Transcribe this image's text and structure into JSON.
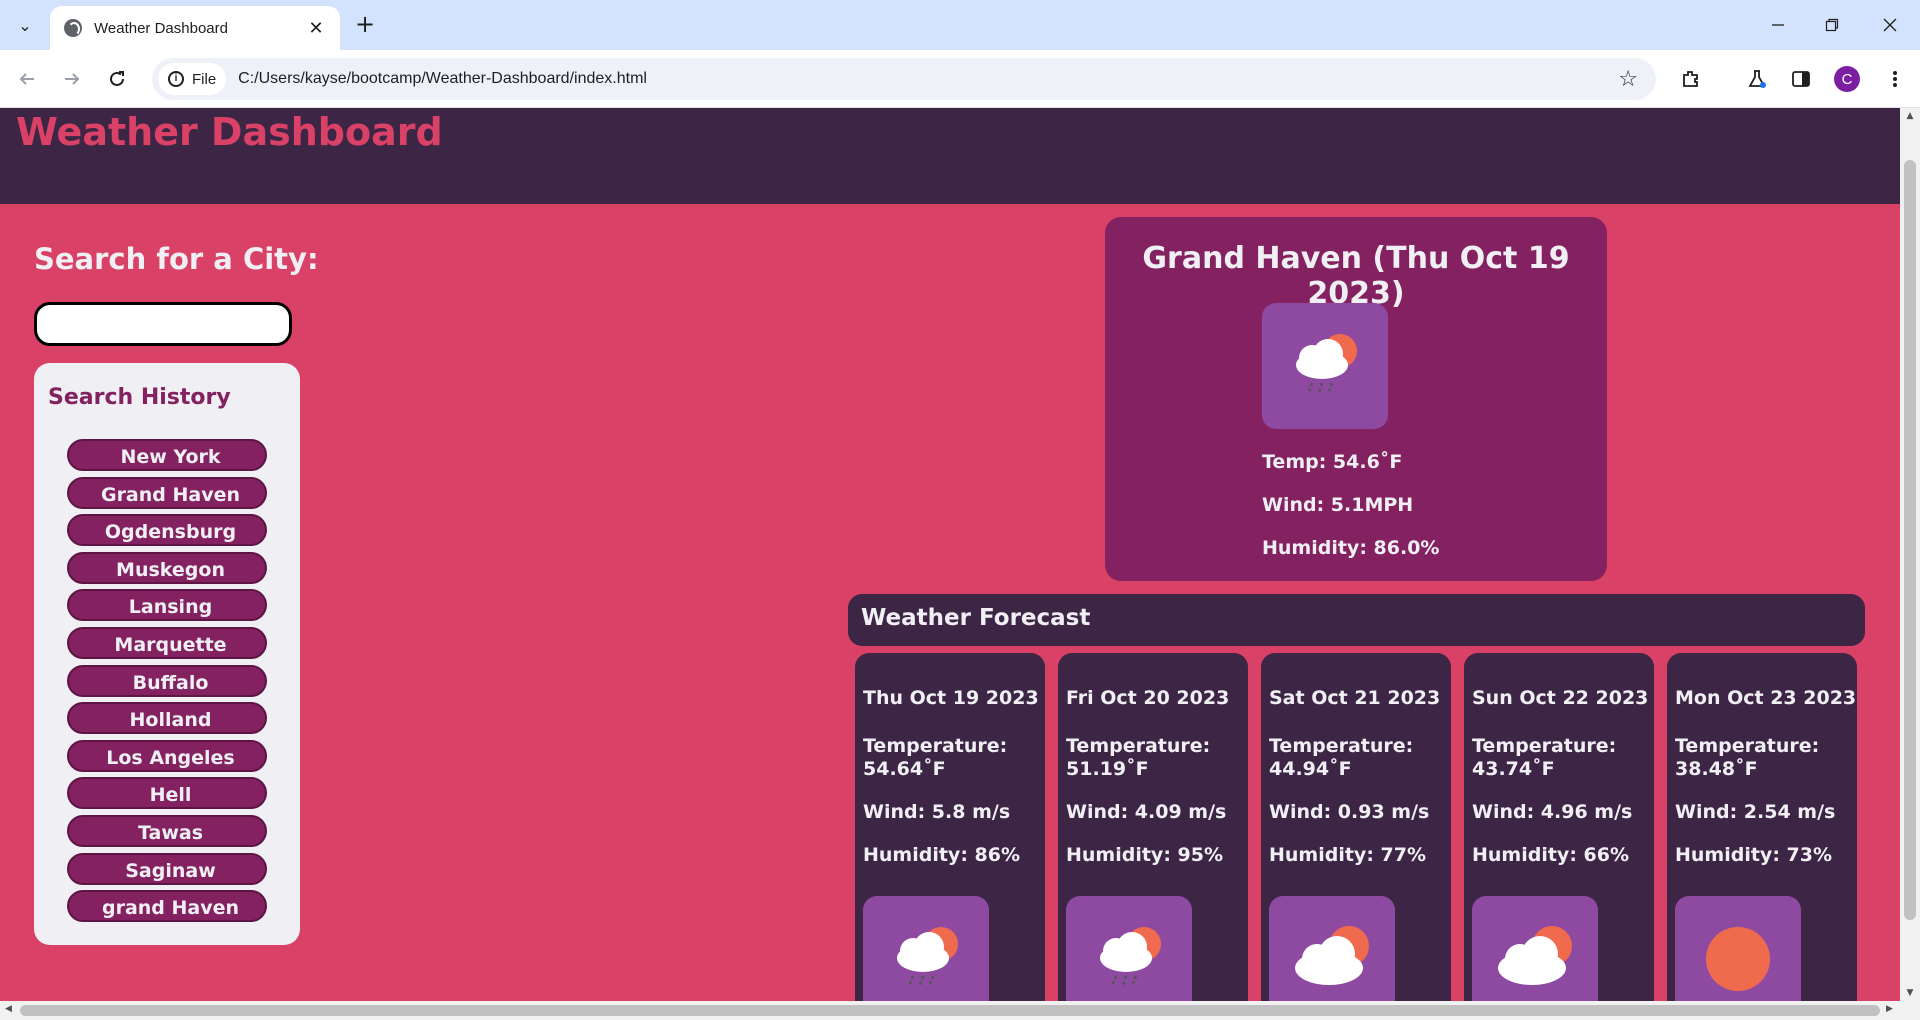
{
  "browser": {
    "tab_title": "Weather Dashboard",
    "tab_close": "✕",
    "new_tab": "+",
    "site_chip": "File",
    "url": "C:/Users/kayse/bootcamp/Weather-Dashboard/index.html",
    "profile_initial": "C"
  },
  "page": {
    "title": "Weather Dashboard",
    "search_label": "Search for a City:",
    "search_value": "",
    "history_title": "Search History",
    "history": [
      "New York",
      "Grand Haven",
      "Ogdensburg",
      "Muskegon",
      "Lansing",
      "Marquette",
      "Buffalo",
      "Holland",
      "Los Angeles",
      "Hell",
      "Tawas",
      "Saginaw",
      "grand Haven"
    ]
  },
  "current": {
    "title": "Grand Haven (Thu Oct 19 2023)",
    "icon": "rain-cloud-sun-icon",
    "temp": "Temp: 54.6˚F",
    "wind": "Wind: 5.1MPH",
    "humidity": "Humidity: 86.0%"
  },
  "forecast": {
    "title": "Weather Forecast",
    "days": [
      {
        "date": "Thu Oct 19 2023",
        "temp_label": "Temperature:",
        "temp": "54.64˚F",
        "wind": "Wind: 5.8 m/s",
        "humidity": "Humidity: 86%",
        "icon": "rain-cloud-sun-icon"
      },
      {
        "date": "Fri Oct 20 2023",
        "temp_label": "Temperature:",
        "temp": "51.19˚F",
        "wind": "Wind: 4.09 m/s",
        "humidity": "Humidity: 95%",
        "icon": "rain-cloud-sun-icon"
      },
      {
        "date": "Sat Oct 21 2023",
        "temp_label": "Temperature:",
        "temp": "44.94˚F",
        "wind": "Wind: 0.93 m/s",
        "humidity": "Humidity: 77%",
        "icon": "cloud-sun-icon"
      },
      {
        "date": "Sun Oct 22 2023",
        "temp_label": "Temperature:",
        "temp": "43.74˚F",
        "wind": "Wind: 4.96 m/s",
        "humidity": "Humidity: 66%",
        "icon": "cloud-sun-icon"
      },
      {
        "date": "Mon Oct 23 2023",
        "temp_label": "Temperature:",
        "temp": "38.48˚F",
        "wind": "Wind: 2.54 m/s",
        "humidity": "Humidity: 73%",
        "icon": "sun-icon"
      }
    ]
  },
  "colors": {
    "header": "#3d2645",
    "page_bg": "#da4167",
    "accent": "#832161",
    "panel_light": "#f0eff4",
    "icon_bg": "#8e4aa0",
    "sun": "#f06b4e"
  }
}
